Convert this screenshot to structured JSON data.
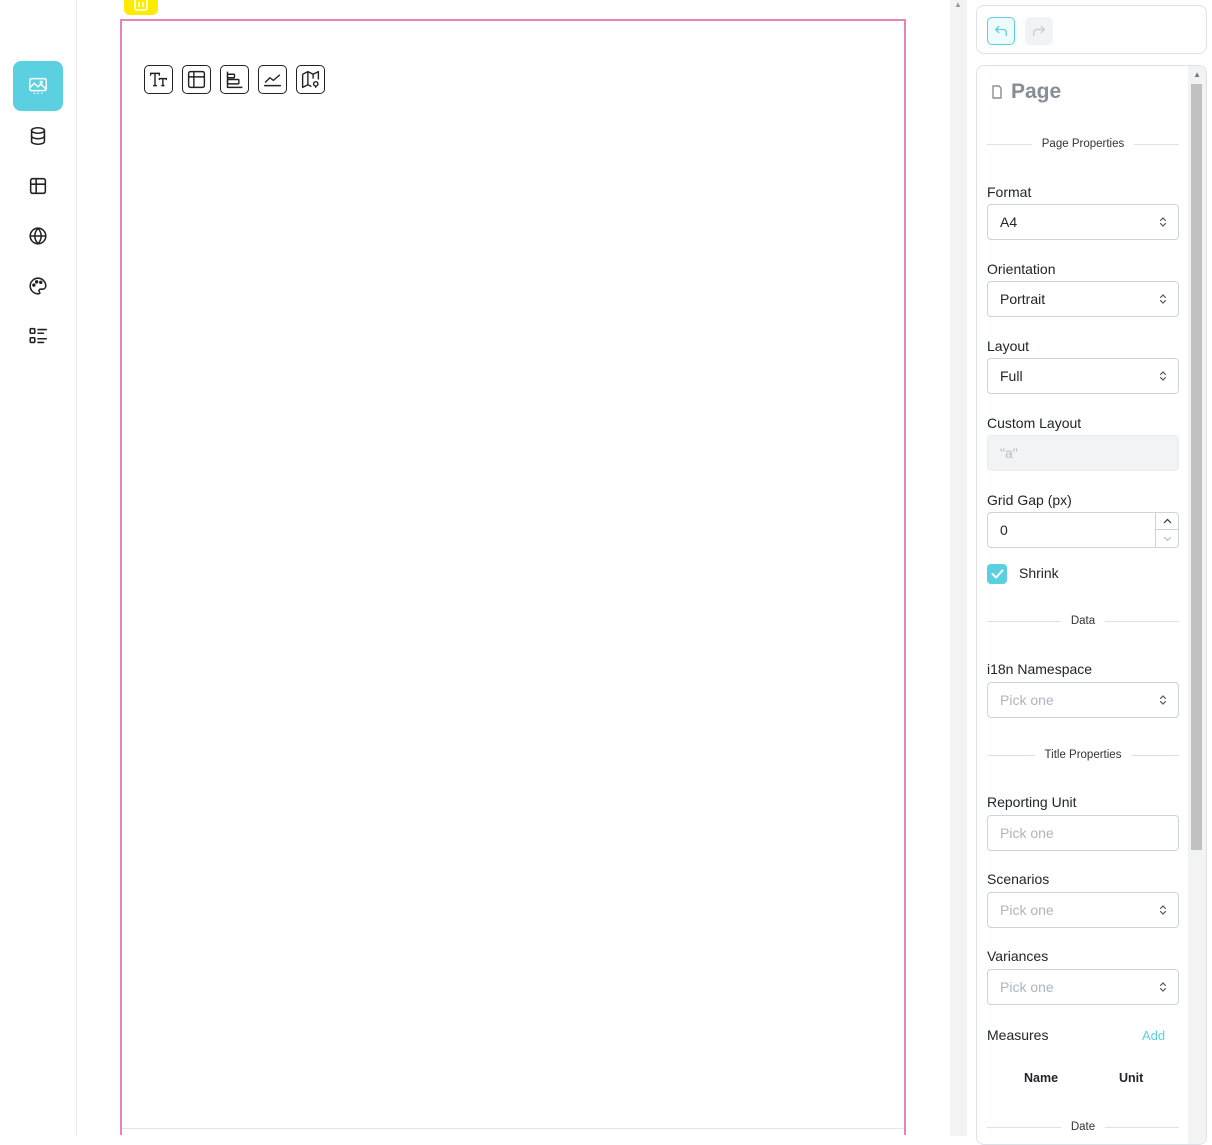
{
  "nav": {
    "items": [
      {
        "icon": "image-icon",
        "active": true
      },
      {
        "icon": "database-icon",
        "active": false
      },
      {
        "icon": "table-icon",
        "active": false
      },
      {
        "icon": "globe-icon",
        "active": false
      },
      {
        "icon": "palette-icon",
        "active": false
      },
      {
        "icon": "list-details-icon",
        "active": false
      }
    ]
  },
  "canvas": {
    "widgets": [
      "text-icon",
      "table-icon",
      "bar-chart-icon",
      "line-chart-icon",
      "map-icon"
    ]
  },
  "panel": {
    "title": "Page",
    "sections": {
      "page_properties": "Page Properties",
      "data": "Data",
      "title_properties": "Title Properties",
      "date": "Date"
    },
    "format": {
      "label": "Format",
      "value": "A4"
    },
    "orientation": {
      "label": "Orientation",
      "value": "Portrait"
    },
    "layout": {
      "label": "Layout",
      "value": "Full"
    },
    "custom_layout": {
      "label": "Custom Layout",
      "value": "\"a\""
    },
    "grid_gap": {
      "label": "Grid Gap (px)",
      "value": "0"
    },
    "shrink": {
      "label": "Shrink",
      "checked": true
    },
    "i18n_namespace": {
      "label": "i18n Namespace",
      "placeholder": "Pick one"
    },
    "reporting_unit": {
      "label": "Reporting Unit",
      "placeholder": "Pick one"
    },
    "scenarios": {
      "label": "Scenarios",
      "placeholder": "Pick one"
    },
    "variances": {
      "label": "Variances",
      "placeholder": "Pick one"
    },
    "measures": {
      "label": "Measures",
      "add_label": "Add",
      "columns": [
        "Name",
        "Unit"
      ]
    }
  },
  "colors": {
    "accent": "#5bd0e0",
    "page_border": "#e685b5",
    "page_tag": "#ffeb00"
  }
}
